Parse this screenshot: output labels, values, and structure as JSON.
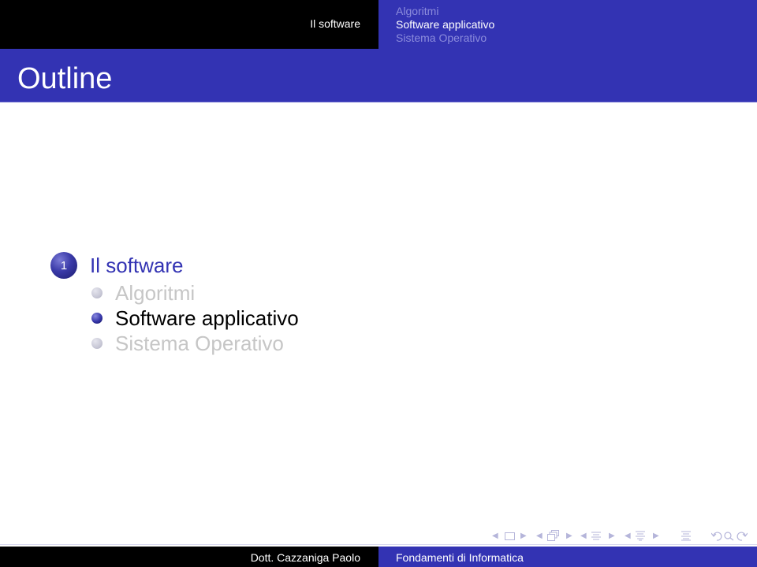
{
  "headline": {
    "section": "Il software",
    "subsections": [
      {
        "label": "Algoritmi",
        "current": false
      },
      {
        "label": "Software applicativo",
        "current": true
      },
      {
        "label": "Sistema Operativo",
        "current": false
      }
    ]
  },
  "frame": {
    "title": "Outline"
  },
  "toc": {
    "sections": [
      {
        "number": "1",
        "label": "Il software",
        "subsections": [
          {
            "label": "Algoritmi",
            "current": false
          },
          {
            "label": "Software applicativo",
            "current": true
          },
          {
            "label": "Sistema Operativo",
            "current": false
          }
        ]
      }
    ]
  },
  "navigation": {
    "icons": [
      "prev-frame-arrow",
      "frame-icon",
      "next-frame-arrow",
      "prev-subsection-arrow",
      "subsection-icon",
      "next-subsection-arrow",
      "prev-section-arrow",
      "section-icon",
      "next-section-arrow",
      "prev-part-arrow",
      "part-icon",
      "next-part-arrow",
      "document-icon",
      "back-icon",
      "search-icon",
      "forward-icon"
    ]
  },
  "footline": {
    "author": "Dott. Cazzaniga Paolo",
    "course": "Fondamenti di Informatica"
  },
  "colors": {
    "structure": "#3333b3",
    "dark": "#000000",
    "inactive_text": "#c6c6c6",
    "nav_symbols": "#b5b5da"
  }
}
